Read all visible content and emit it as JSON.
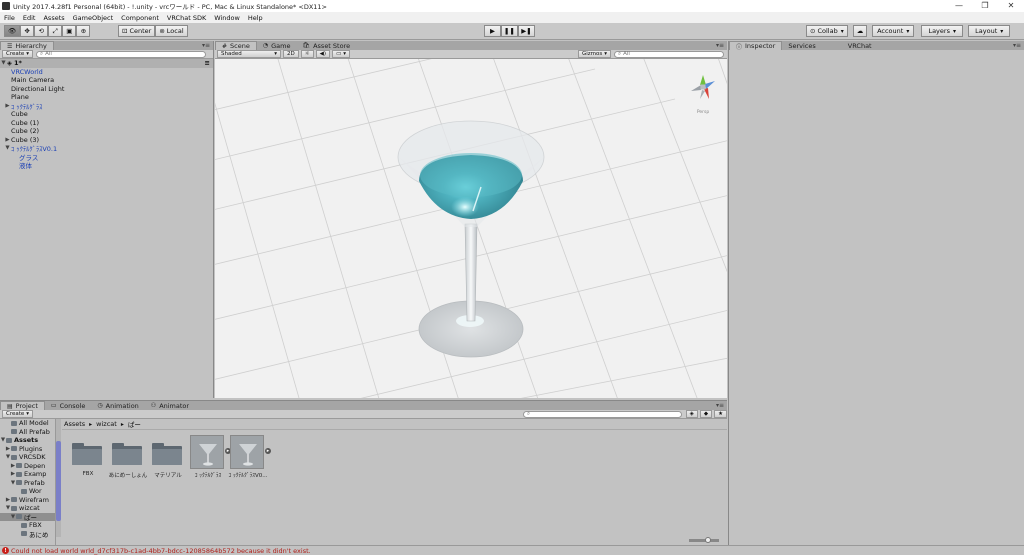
{
  "window": {
    "title": "Unity 2017.4.28f1 Personal (64bit) - !.unity - vrcワールド - PC, Mac & Linux Standalone* <DX11>",
    "controls": [
      "—",
      "❐",
      "✕"
    ]
  },
  "menu": [
    "File",
    "Edit",
    "Assets",
    "GameObject",
    "Component",
    "VRChat SDK",
    "Window",
    "Help"
  ],
  "toolbar": {
    "pivot_label": "Center",
    "space_label": "Local",
    "collab_label": "Collab",
    "account_label": "Account",
    "layers_label": "Layers",
    "layout_label": "Layout"
  },
  "hierarchy": {
    "tab": "Hierarchy",
    "create_label": "Create",
    "search_placeholder": "All",
    "scene_name": "1*",
    "items": [
      {
        "label": "VRCWorld",
        "indent": 1,
        "arrow": "",
        "blue": true
      },
      {
        "label": "Main Camera",
        "indent": 1,
        "arrow": "",
        "blue": false
      },
      {
        "label": "Directional Light",
        "indent": 1,
        "arrow": "",
        "blue": false
      },
      {
        "label": "Plane",
        "indent": 1,
        "arrow": "",
        "blue": false
      },
      {
        "label": "ｺ ｯｸﾃﾙｸﾞﾗｽ",
        "indent": 1,
        "arrow": "▶",
        "blue": true
      },
      {
        "label": "Cube",
        "indent": 1,
        "arrow": "",
        "blue": false
      },
      {
        "label": "Cube (1)",
        "indent": 1,
        "arrow": "",
        "blue": false
      },
      {
        "label": "Cube (2)",
        "indent": 1,
        "arrow": "",
        "blue": false
      },
      {
        "label": "Cube (3)",
        "indent": 1,
        "arrow": "▶",
        "blue": false
      },
      {
        "label": "ｺ ｯｸﾃﾙｸﾞﾗｽV0.1",
        "indent": 1,
        "arrow": "▼",
        "blue": true
      },
      {
        "label": "グラス",
        "indent": 2,
        "arrow": "",
        "blue": true
      },
      {
        "label": "液体",
        "indent": 2,
        "arrow": "",
        "blue": true
      }
    ]
  },
  "scene": {
    "tabs": [
      "Scene",
      "Game",
      "Asset Store"
    ],
    "shading": "Shaded",
    "mode_2d": "2D",
    "gizmos_label": "Gizmos",
    "search_placeholder": "All",
    "persp_label": "Persp"
  },
  "inspector": {
    "tabs": [
      "Inspector",
      "Services",
      "VRChat"
    ]
  },
  "project": {
    "tabs": [
      "Project",
      "Console",
      "Animation",
      "Animator"
    ],
    "create_label": "Create",
    "breadcrumb": [
      "Assets",
      "wizcat",
      "ぱー"
    ],
    "tree": [
      {
        "label": "All Model",
        "indent": 1,
        "arrow": ""
      },
      {
        "label": "All Prefab",
        "indent": 1,
        "arrow": ""
      },
      {
        "label": "Assets",
        "indent": 0,
        "arrow": "▼",
        "bold": true
      },
      {
        "label": "Plugins",
        "indent": 1,
        "arrow": "▶"
      },
      {
        "label": "VRCSDK",
        "indent": 1,
        "arrow": "▼"
      },
      {
        "label": "Depen",
        "indent": 2,
        "arrow": "▶"
      },
      {
        "label": "Examp",
        "indent": 2,
        "arrow": "▶"
      },
      {
        "label": "Prefab",
        "indent": 2,
        "arrow": "▼"
      },
      {
        "label": "Wor",
        "indent": 3,
        "arrow": ""
      },
      {
        "label": "Wirefram",
        "indent": 1,
        "arrow": "▶"
      },
      {
        "label": "wizcat",
        "indent": 1,
        "arrow": "▼"
      },
      {
        "label": "ぱー",
        "indent": 2,
        "arrow": "▼",
        "selected": true
      },
      {
        "label": "FBX",
        "indent": 3,
        "arrow": ""
      },
      {
        "label": "あにめ",
        "indent": 3,
        "arrow": ""
      }
    ],
    "assets": [
      {
        "label": "FBX",
        "kind": "folder"
      },
      {
        "label": "あにめーしょん",
        "kind": "folder"
      },
      {
        "label": "マテリアル",
        "kind": "folder"
      },
      {
        "label": "ｺ ｯｸﾃﾙｸﾞﾗｽ",
        "kind": "model"
      },
      {
        "label": "ｺ ｯｸﾃﾙｸﾞﾗｽV0...",
        "kind": "model"
      }
    ]
  },
  "status": {
    "message": "Could not load world wrld_d7cf317b-c1ad-4bb7-bdcc-12085864b572 because it didn't exist."
  },
  "colors": {
    "accent_blue": "#1a3fb5",
    "error_red": "#c8201a",
    "liquid": "#47a9b6"
  }
}
